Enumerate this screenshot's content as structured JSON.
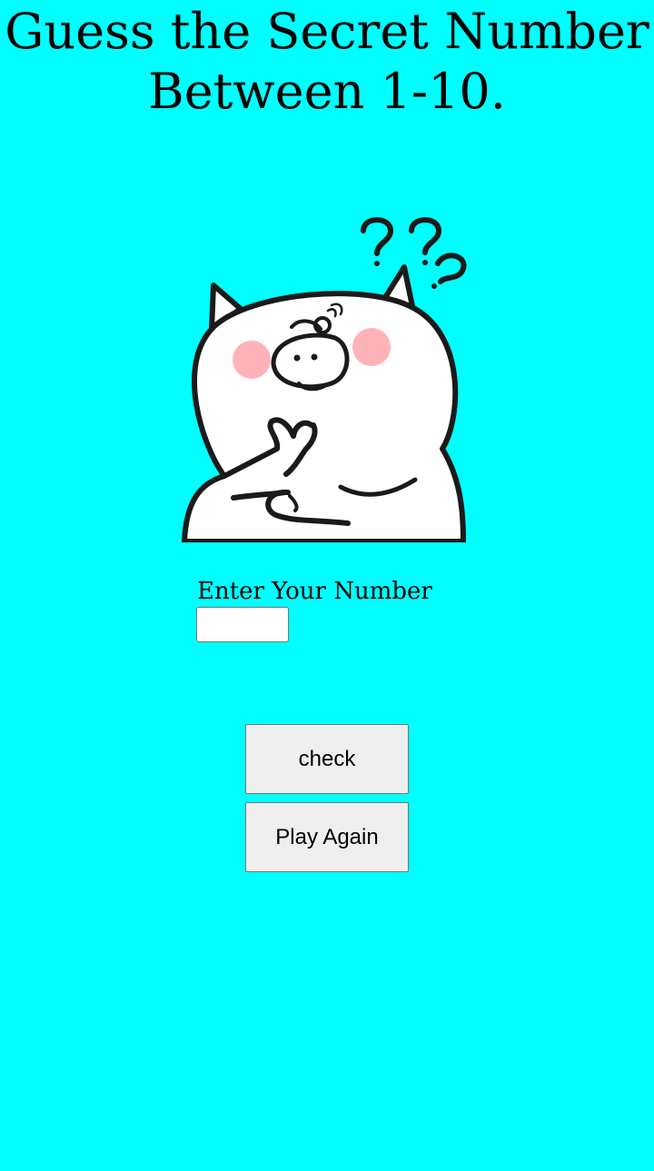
{
  "header": {
    "title": "Guess the Secret Number Between 1-10."
  },
  "illustration": {
    "icon": "thinking-pig-icon",
    "question_marks": [
      "?",
      "?",
      "?"
    ]
  },
  "form": {
    "label": "Enter Your Number",
    "input_value": "",
    "input_placeholder": ""
  },
  "buttons": {
    "check_label": "check",
    "play_again_label": "Play Again"
  },
  "colors": {
    "background": "#00ffff",
    "button_bg": "#efefef",
    "blush": "#ffb3b8",
    "outline": "#1a1a1a"
  }
}
